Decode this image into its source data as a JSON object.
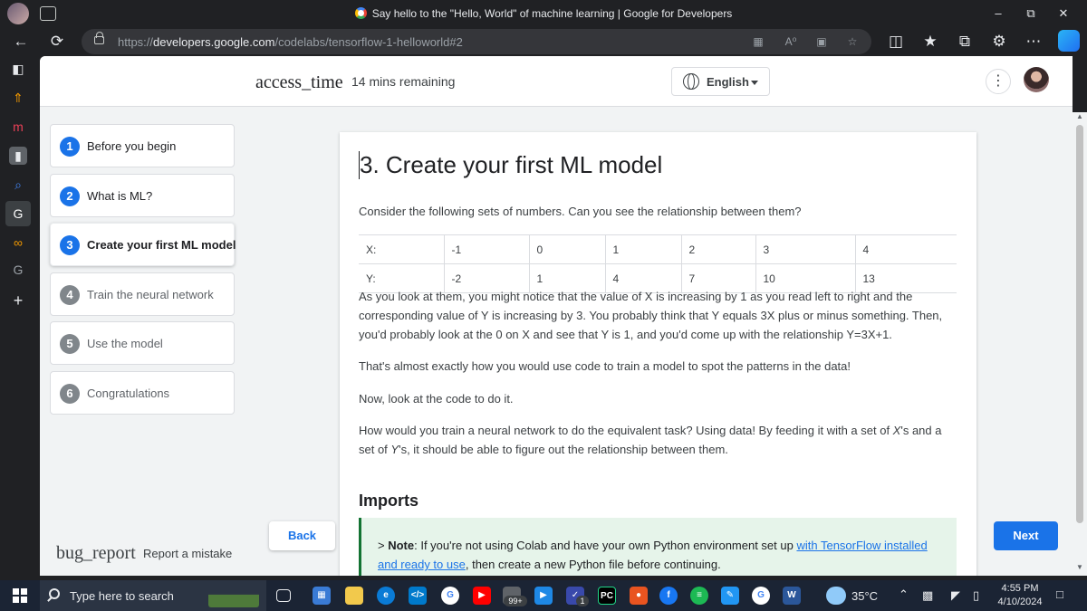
{
  "browser": {
    "tab_title": "Say hello to the \"Hello, World\" of machine learning  |  Google for Developers",
    "url_prefix": "https://",
    "url_domain": "developers.google.com",
    "url_path": "/codelabs/tensorflow-1-helloworld#2"
  },
  "header": {
    "time_icon": "access_time",
    "time_remaining": "14 mins remaining",
    "language": "English"
  },
  "steps": [
    {
      "num": "1",
      "label": "Before you begin",
      "state": "done"
    },
    {
      "num": "2",
      "label": "What is ML?",
      "state": "done"
    },
    {
      "num": "3",
      "label": "Create your first ML model",
      "state": "active"
    },
    {
      "num": "4",
      "label": "Train the neural network",
      "state": "todo"
    },
    {
      "num": "5",
      "label": "Use the model",
      "state": "todo"
    },
    {
      "num": "6",
      "label": "Congratulations",
      "state": "todo"
    }
  ],
  "footer": {
    "bug_icon": "bug_report",
    "report": "Report a mistake",
    "back": "Back",
    "next": "Next"
  },
  "content": {
    "title": "3. Create your first ML model",
    "intro": "Consider the following sets of numbers. Can you see the relationship between them?",
    "table": {
      "x_label": "X:",
      "x_values": [
        "-1",
        "0",
        "1",
        "2",
        "3",
        "4"
      ],
      "y_label": "Y:",
      "y_values": [
        "-2",
        "1",
        "4",
        "7",
        "10",
        "13"
      ]
    },
    "para1": "As you look at them, you might notice that the value of X is increasing by 1 as you read left to right and the corresponding value of Y is increasing by 3. You probably think that Y equals 3X plus or minus something. Then, you'd probably look at the 0 on X and see that Y is 1, and you'd come up with the relationship Y=3X+1.",
    "para2": "That's almost exactly how you would use code to train a model to spot the patterns in the data!",
    "para3": "Now, look at the code to do it.",
    "para4_a": "How would you train a neural network to do the equivalent task? Using data! By feeding it with a set of ",
    "para4_x": "X",
    "para4_b": "'s and a set of ",
    "para4_y": "Y",
    "para4_c": "'s, it should be able to figure out the relationship between them.",
    "imports_heading": "Imports",
    "note_prefix": "> ",
    "note_bold": "Note",
    "note_text": ": If you're not using Colab and have your own Python environment set up ",
    "note_link": "with TensorFlow installed and ready to use",
    "note_end": ", then create a new Python file before continuing."
  },
  "taskbar": {
    "search_placeholder": "Type here to search",
    "badge_99": "99+",
    "badge_1": "1",
    "weather": "35°C",
    "time": "4:55 PM",
    "date": "4/10/2024",
    "accent_colors": {
      "edge": "#0a7bd6",
      "vscode": "#007acc",
      "youtube": "#ff0000",
      "spotify": "#1db954",
      "word": "#2b579a"
    }
  }
}
